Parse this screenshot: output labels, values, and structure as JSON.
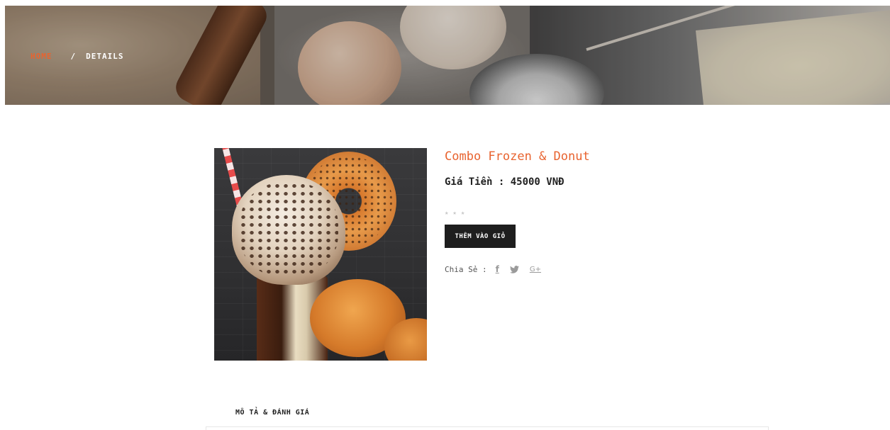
{
  "breadcrumb": {
    "home": "HOME",
    "separator": "/",
    "current": "DETAILS"
  },
  "product": {
    "title": "Combo Frozen & Donut",
    "price": "Giá Tiền : 45000 VNĐ",
    "rating_stars": [
      "★",
      "★",
      "★"
    ],
    "add_to_cart_label": "THÊM VÀO GIỎ",
    "image_alt": "Combo Frozen & Donut product photo"
  },
  "share": {
    "label": "Chia Sẻ :",
    "icons": [
      "facebook-icon",
      "twitter-icon",
      "google-plus-icon"
    ],
    "facebook_glyph": "f",
    "twitter_glyph": "🐦",
    "google_plus_glyph": "G+"
  },
  "tabs": {
    "description_reviews": "MÔ TẢ & ĐÁNH GIÁ"
  },
  "colors": {
    "accent": "#e8632f",
    "button_bg": "#1e1e1e",
    "text_dark": "#222222",
    "star_gray": "#c9c9c9"
  }
}
